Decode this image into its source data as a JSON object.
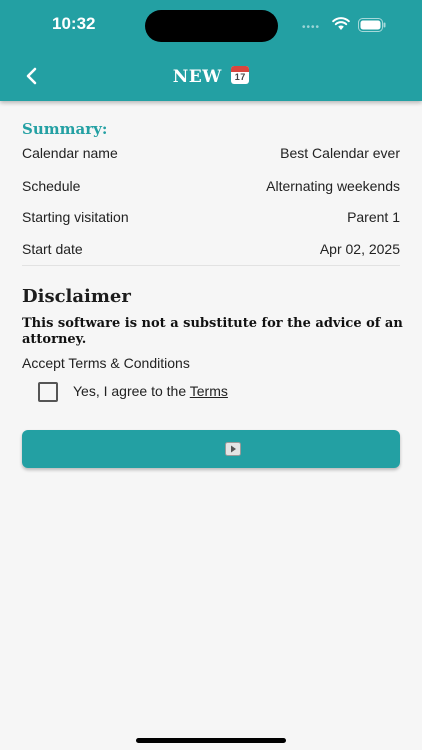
{
  "status_bar": {
    "time": "10:32",
    "dots": "••••"
  },
  "header": {
    "title": "NEW",
    "title_icon": "calendar-emoji-icon",
    "calendar_day": "17"
  },
  "summary": {
    "heading": "Summary:",
    "rows": [
      {
        "label": "Calendar name",
        "value": "Best Calendar ever"
      },
      {
        "label": "Schedule",
        "value": "Alternating weekends"
      },
      {
        "label": "Starting visitation",
        "value": "Parent 1"
      },
      {
        "label": "Start date",
        "value": "Apr 02, 2025"
      }
    ]
  },
  "disclaimer": {
    "heading": "Disclaimer",
    "text": "This software is not a substitute for the advice of an attorney.",
    "accept_label": "Accept Terms & Conditions",
    "agree_prefix": "Yes, I agree to the ",
    "terms_link": "Terms",
    "checked": false
  },
  "next_button": {
    "icon": "play-button-icon"
  },
  "colors": {
    "accent": "#23a0a3",
    "background": "#f6f6f6"
  }
}
